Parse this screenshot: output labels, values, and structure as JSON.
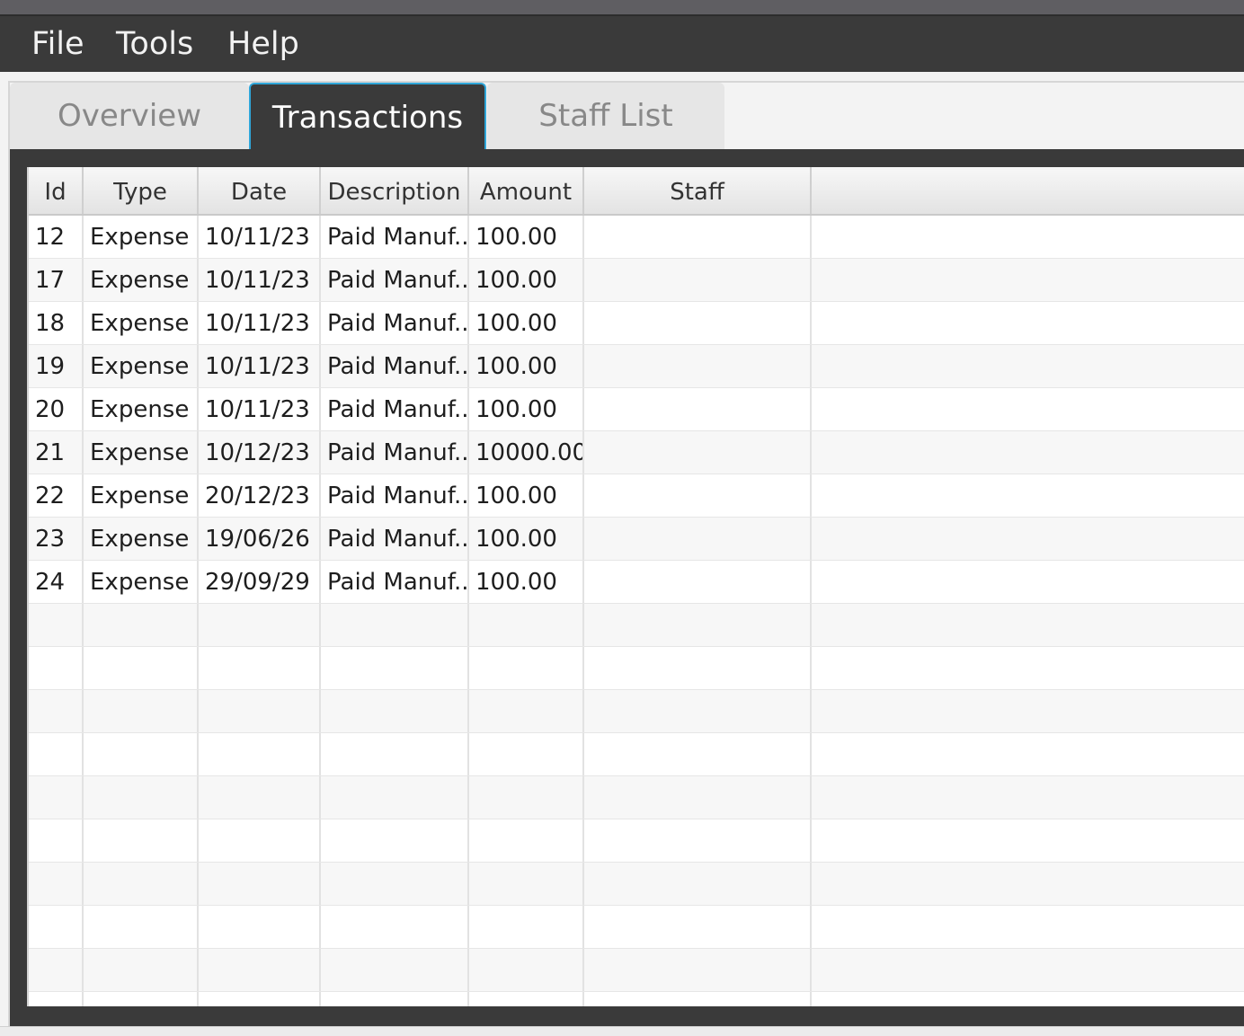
{
  "menu": {
    "file": "File",
    "tools": "Tools",
    "help": "Help"
  },
  "tabs": [
    {
      "label": "Overview",
      "selected": false
    },
    {
      "label": "Transactions",
      "selected": true
    },
    {
      "label": "Staff List",
      "selected": false
    }
  ],
  "table": {
    "columns": [
      "Id",
      "Type",
      "Date",
      "Description",
      "Amount",
      "Staff",
      ""
    ],
    "rows": [
      [
        "12",
        "Expense",
        "10/11/23",
        "Paid Manuf...",
        "100.00",
        "",
        ""
      ],
      [
        "17",
        "Expense",
        "10/11/23",
        "Paid Manuf...",
        "100.00",
        "",
        ""
      ],
      [
        "18",
        "Expense",
        "10/11/23",
        "Paid Manuf...",
        "100.00",
        "",
        ""
      ],
      [
        "19",
        "Expense",
        "10/11/23",
        "Paid Manuf...",
        "100.00",
        "",
        ""
      ],
      [
        "20",
        "Expense",
        "10/11/23",
        "Paid Manuf...",
        "100.00",
        "",
        ""
      ],
      [
        "21",
        "Expense",
        "10/12/23",
        "Paid Manuf...",
        "10000.00",
        "",
        ""
      ],
      [
        "22",
        "Expense",
        "20/12/23",
        "Paid Manuf...",
        "100.00",
        "",
        ""
      ],
      [
        "23",
        "Expense",
        "19/06/26",
        "Paid Manuf...",
        "100.00",
        "",
        ""
      ],
      [
        "24",
        "Expense",
        "29/09/29",
        "Paid Manuf...",
        "100.00",
        "",
        ""
      ]
    ],
    "empty_rows": 10
  },
  "colors": {
    "menubar": "#3a3a3a",
    "selected_tab_border": "#2fa6d9",
    "row_stripe": "#f7f7f7"
  }
}
